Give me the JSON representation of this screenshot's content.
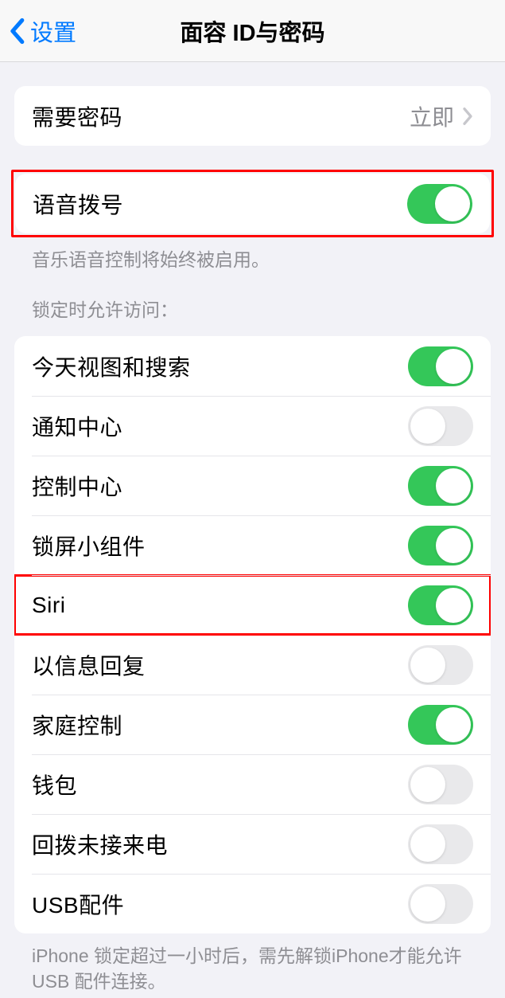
{
  "nav": {
    "back_label": "设置",
    "title": "面容 ID与密码"
  },
  "passcode": {
    "label": "需要密码",
    "value": "立即"
  },
  "voice_dial": {
    "label": "语音拨号",
    "footer": "音乐语音控制将始终被启用。",
    "on": true
  },
  "locked_access": {
    "header": "锁定时允许访问：",
    "items": [
      {
        "label": "今天视图和搜索",
        "on": true
      },
      {
        "label": "通知中心",
        "on": false
      },
      {
        "label": "控制中心",
        "on": true
      },
      {
        "label": "锁屏小组件",
        "on": true
      },
      {
        "label": "Siri",
        "on": true,
        "highlight": true
      },
      {
        "label": "以信息回复",
        "on": false
      },
      {
        "label": "家庭控制",
        "on": true
      },
      {
        "label": "钱包",
        "on": false
      },
      {
        "label": "回拨未接来电",
        "on": false
      },
      {
        "label": "USB配件",
        "on": false
      }
    ],
    "footer": "iPhone 锁定超过一小时后，需先解锁iPhone才能允许USB 配件连接。"
  }
}
